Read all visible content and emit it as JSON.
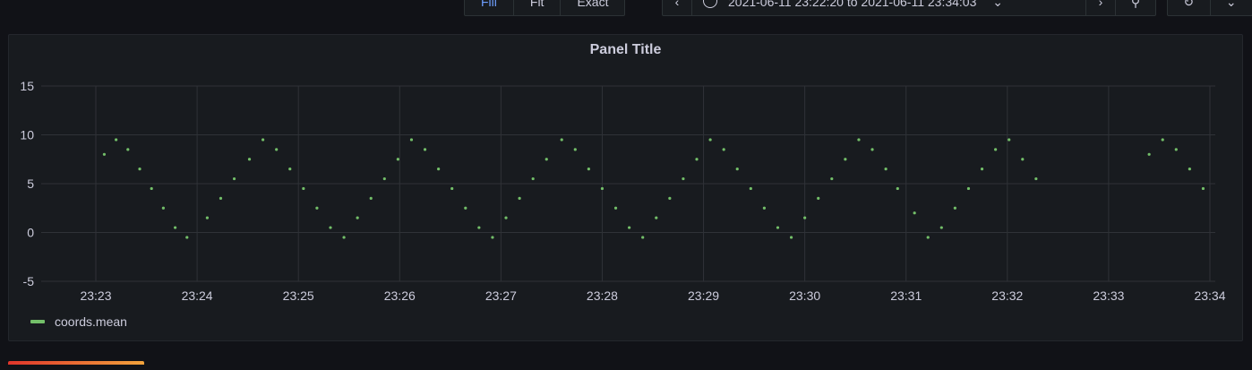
{
  "toolbar": {
    "zoom_modes": [
      {
        "label": "Fill",
        "active": true
      },
      {
        "label": "Fit",
        "active": false
      },
      {
        "label": "Exact",
        "active": false
      }
    ],
    "time_range": "2021-06-11 23:22:20 to 2021-06-11 23:34:03",
    "icons": {
      "prev": "chevron-left-icon",
      "clock": "clock-icon",
      "caret": "caret-down-icon",
      "next": "chevron-right-icon",
      "zoom": "zoom-out-icon",
      "refresh": "refresh-icon",
      "refresh_caret": "caret-down-icon"
    }
  },
  "panel": {
    "title": "Panel Title",
    "legend": [
      {
        "name": "coords.mean",
        "color": "#73bf69"
      }
    ]
  },
  "chart_data": {
    "type": "scatter",
    "ylim": [
      -5,
      15
    ],
    "yticks": [
      15,
      10,
      5,
      0,
      -5
    ],
    "xticks": [
      "23:23",
      "23:24",
      "23:25",
      "23:26",
      "23:27",
      "23:28",
      "23:29",
      "23:30",
      "23:31",
      "23:32",
      "23:33",
      "23:34"
    ],
    "grid": true,
    "legend_position": "bottom-left",
    "series": [
      {
        "name": "coords.mean",
        "color": "#73bf69",
        "points": [
          [
            "23:23:05",
            8
          ],
          [
            "23:23:12",
            9.5
          ],
          [
            "23:23:19",
            8.5
          ],
          [
            "23:23:26",
            6.5
          ],
          [
            "23:23:33",
            4.5
          ],
          [
            "23:23:40",
            2.5
          ],
          [
            "23:23:47",
            0.5
          ],
          [
            "23:23:54",
            -0.5
          ],
          [
            "23:24:06",
            1.5
          ],
          [
            "23:24:14",
            3.5
          ],
          [
            "23:24:22",
            5.5
          ],
          [
            "23:24:31",
            7.5
          ],
          [
            "23:24:39",
            9.5
          ],
          [
            "23:24:47",
            8.5
          ],
          [
            "23:24:55",
            6.5
          ],
          [
            "23:25:03",
            4.5
          ],
          [
            "23:25:11",
            2.5
          ],
          [
            "23:25:19",
            0.5
          ],
          [
            "23:25:27",
            -0.5
          ],
          [
            "23:25:35",
            1.5
          ],
          [
            "23:25:43",
            3.5
          ],
          [
            "23:25:51",
            5.5
          ],
          [
            "23:25:59",
            7.5
          ],
          [
            "23:26:07",
            9.5
          ],
          [
            "23:26:15",
            8.5
          ],
          [
            "23:26:23",
            6.5
          ],
          [
            "23:26:31",
            4.5
          ],
          [
            "23:26:39",
            2.5
          ],
          [
            "23:26:47",
            0.5
          ],
          [
            "23:26:55",
            -0.5
          ],
          [
            "23:27:03",
            1.5
          ],
          [
            "23:27:11",
            3.5
          ],
          [
            "23:27:19",
            5.5
          ],
          [
            "23:27:27",
            7.5
          ],
          [
            "23:27:36",
            9.5
          ],
          [
            "23:27:44",
            8.5
          ],
          [
            "23:27:52",
            6.5
          ],
          [
            "23:28:00",
            4.5
          ],
          [
            "23:28:08",
            2.5
          ],
          [
            "23:28:16",
            0.5
          ],
          [
            "23:28:24",
            -0.5
          ],
          [
            "23:28:32",
            1.5
          ],
          [
            "23:28:40",
            3.5
          ],
          [
            "23:28:48",
            5.5
          ],
          [
            "23:28:56",
            7.5
          ],
          [
            "23:29:04",
            9.5
          ],
          [
            "23:29:12",
            8.5
          ],
          [
            "23:29:20",
            6.5
          ],
          [
            "23:29:28",
            4.5
          ],
          [
            "23:29:36",
            2.5
          ],
          [
            "23:29:44",
            0.5
          ],
          [
            "23:29:52",
            -0.5
          ],
          [
            "23:30:00",
            1.5
          ],
          [
            "23:30:08",
            3.5
          ],
          [
            "23:30:16",
            5.5
          ],
          [
            "23:30:24",
            7.5
          ],
          [
            "23:30:32",
            9.5
          ],
          [
            "23:30:40",
            8.5
          ],
          [
            "23:30:48",
            6.5
          ],
          [
            "23:30:55",
            4.5
          ],
          [
            "23:31:05",
            2
          ],
          [
            "23:31:13",
            -0.5
          ],
          [
            "23:31:21",
            0.5
          ],
          [
            "23:31:29",
            2.5
          ],
          [
            "23:31:37",
            4.5
          ],
          [
            "23:31:45",
            6.5
          ],
          [
            "23:31:53",
            8.5
          ],
          [
            "23:32:01",
            9.5
          ],
          [
            "23:32:09",
            7.5
          ],
          [
            "23:32:17",
            5.5
          ],
          [
            "23:33:24",
            8
          ],
          [
            "23:33:32",
            9.5
          ],
          [
            "23:33:40",
            8.5
          ],
          [
            "23:33:48",
            6.5
          ],
          [
            "23:33:56",
            4.5
          ]
        ]
      }
    ]
  }
}
